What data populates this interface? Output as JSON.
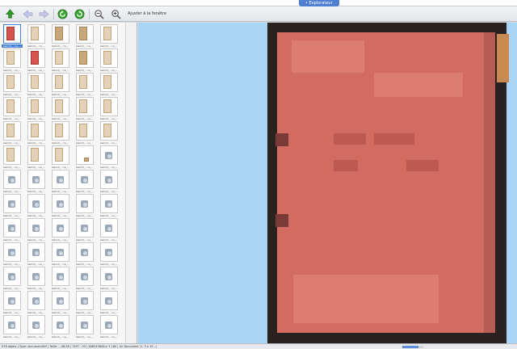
{
  "window": {
    "tab_label": "• Explorateur"
  },
  "toolbar": {
    "buttons": [
      {
        "name": "up-folder",
        "icon": "arrow-up-green-icon"
      },
      {
        "name": "back",
        "icon": "arrow-left-icon"
      },
      {
        "name": "forward",
        "icon": "arrow-right-icon"
      },
      {
        "name": "rotate-left",
        "icon": "rotate-left-green-icon"
      },
      {
        "name": "rotate-right",
        "icon": "rotate-right-green-icon"
      },
      {
        "name": "zoom-out",
        "icon": "zoom-out-icon"
      },
      {
        "name": "zoom-in",
        "icon": "zoom-in-icon"
      }
    ],
    "fit_label": "Ajuster à la fenêtre"
  },
  "thumbnails": {
    "caption": "bwindi_...ce_...",
    "items": [
      "red-selected",
      "light",
      "tan",
      "tan",
      "light",
      "light",
      "red",
      "light",
      "tan",
      "light",
      "light",
      "light",
      "light",
      "light",
      "light",
      "light",
      "light",
      "light",
      "light",
      "light",
      "light",
      "light",
      "light",
      "light",
      "light",
      "light",
      "light",
      "light",
      "small",
      "placeholder",
      "placeholder",
      "placeholder",
      "placeholder",
      "placeholder",
      "placeholder",
      "placeholder",
      "placeholder",
      "placeholder",
      "placeholder",
      "placeholder",
      "placeholder",
      "placeholder",
      "placeholder",
      "placeholder",
      "placeholder",
      "placeholder",
      "placeholder",
      "placeholder",
      "placeholder",
      "placeholder",
      "placeholder",
      "placeholder",
      "placeholder",
      "placeholder",
      "placeholder",
      "placeholder",
      "placeholder",
      "placeholder",
      "placeholder",
      "placeholder",
      "placeholder",
      "placeholder",
      "placeholder",
      "placeholder",
      "placeholder"
    ]
  },
  "viewer": {
    "page_color": "#d26b61",
    "background": "#a9d6f5"
  },
  "statusbar": {
    "text": "978 objets  |  Type: document/tiff  |  Taille: ...08:28  |  7497 - 03  |  48654360Sur 3 180  |  Un Document (1. 3 x 15...)",
    "progress": 0.75
  }
}
